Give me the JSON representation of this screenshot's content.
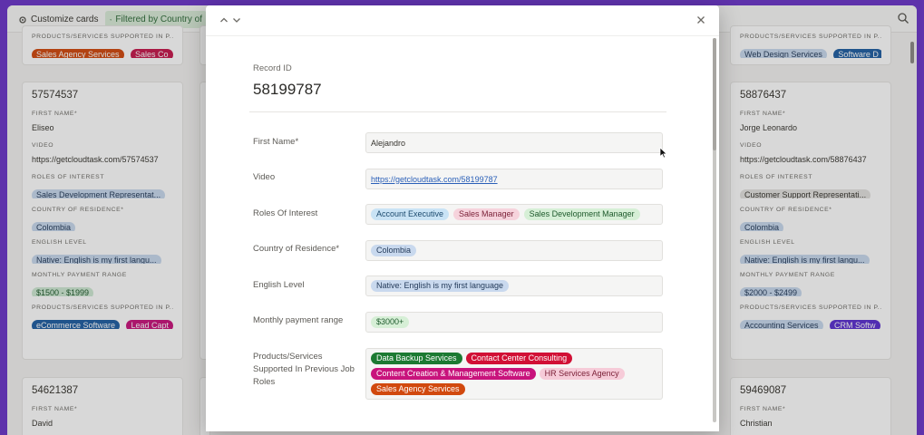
{
  "toolbar": {
    "customize_label": "Customize cards",
    "filter_label": "Filtered by Country of"
  },
  "background_cards": {
    "top_left": {
      "field_label": "PRODUCTS/SERVICES SUPPORTED IN P...",
      "tags": [
        {
          "label": "Sales Agency Services",
          "bg": "#d1490e",
          "fg": "#ffffff"
        },
        {
          "label": "Sales Co",
          "bg": "#c6184c",
          "fg": "#ffffff"
        }
      ]
    },
    "top_right": {
      "field_label": "PRODUCTS/SERVICES SUPPORTED IN P...",
      "tags": [
        {
          "label": "Web Design Services",
          "bg": "#c9d9ee",
          "fg": "#243b5a"
        },
        {
          "label": "Software D",
          "bg": "#1f5fa3",
          "fg": "#ffffff"
        }
      ]
    },
    "left": {
      "title": "57574537",
      "first_name_label": "FIRST NAME*",
      "first_name": "Eliseo",
      "video_label": "VIDEO",
      "video": "https://getcloudtask.com/57574537",
      "roles_label": "ROLES OF INTEREST",
      "role_tag": {
        "label": "Sales Development Representat...",
        "bg": "#c9d9ee",
        "fg": "#243b5a"
      },
      "country_label": "COUNTRY OF RESIDENCE*",
      "country_tag": {
        "label": "Colombia",
        "bg": "#c9d9ee",
        "fg": "#243b5a"
      },
      "english_label": "ENGLISH LEVEL",
      "english_tag": {
        "label": "Native: English is my first langu...",
        "bg": "#c9d9ee",
        "fg": "#243b5a"
      },
      "payment_label": "MONTHLY PAYMENT RANGE",
      "payment_tag": {
        "label": "$1500 - $1999",
        "bg": "#cfe9d3",
        "fg": "#1e5a2c"
      },
      "products_label": "PRODUCTS/SERVICES SUPPORTED IN P...",
      "products_tags": [
        {
          "label": "eCommerce Software",
          "bg": "#1f5fa3",
          "fg": "#ffffff"
        },
        {
          "label": "Lead Capt",
          "bg": "#c8137c",
          "fg": "#ffffff"
        }
      ]
    },
    "right": {
      "title": "58876437",
      "first_name_label": "FIRST NAME*",
      "first_name": "Jorge Leonardo",
      "video_label": "VIDEO",
      "video": "https://getcloudtask.com/58876437",
      "roles_label": "ROLES OF INTEREST",
      "role_tag": {
        "label": "Customer Support Representati...",
        "bg": "#e3e2e0",
        "fg": "#37352f"
      },
      "country_label": "COUNTRY OF RESIDENCE*",
      "country_tag": {
        "label": "Colombia",
        "bg": "#c9d9ee",
        "fg": "#243b5a"
      },
      "english_label": "ENGLISH LEVEL",
      "english_tag": {
        "label": "Native: English is my first langu...",
        "bg": "#c9d9ee",
        "fg": "#243b5a"
      },
      "payment_label": "MONTHLY PAYMENT RANGE",
      "payment_tag": {
        "label": "$2000 - $2499",
        "bg": "#c9d9ee",
        "fg": "#243b5a"
      },
      "products_label": "PRODUCTS/SERVICES SUPPORTED IN P...",
      "products_tags": [
        {
          "label": "Accounting Services",
          "bg": "#c9d9ee",
          "fg": "#243b5a"
        },
        {
          "label": "CRM Softw",
          "bg": "#5b2fd1",
          "fg": "#ffffff"
        }
      ]
    },
    "bottom_left": {
      "title": "54621387",
      "first_name_label": "FIRST NAME*",
      "first_name": "David"
    },
    "bottom_right": {
      "title": "59469087",
      "first_name_label": "FIRST NAME*",
      "first_name": "Christian"
    }
  },
  "modal": {
    "record_id_label": "Record ID",
    "record_id": "58199787",
    "fields": {
      "first_name": {
        "label": "First Name*",
        "value": "Alejandro"
      },
      "video": {
        "label": "Video",
        "value": "https://getcloudtask.com/58199787"
      },
      "roles": {
        "label": "Roles Of Interest",
        "tags": [
          {
            "label": "Account Executive",
            "bg": "#c9e3f5",
            "fg": "#1c4a6e"
          },
          {
            "label": "Sales Manager",
            "bg": "#f6d3dc",
            "fg": "#7a1f36"
          },
          {
            "label": "Sales Development Manager",
            "bg": "#d6efd6",
            "fg": "#1e5a2c"
          }
        ]
      },
      "country": {
        "label": "Country of Residence*",
        "tags": [
          {
            "label": "Colombia",
            "bg": "#c9d9ee",
            "fg": "#243b5a"
          }
        ]
      },
      "english": {
        "label": "English Level",
        "tags": [
          {
            "label": "Native: English is my first language",
            "bg": "#c9d9ee",
            "fg": "#243b5a"
          }
        ]
      },
      "payment": {
        "label": "Monthly payment range",
        "tags": [
          {
            "label": "$3000+",
            "bg": "#d6efd6",
            "fg": "#1e5a2c"
          }
        ]
      },
      "products": {
        "label": "Products/Services Supported In Previous Job Roles",
        "tags": [
          {
            "label": "Data Backup Services",
            "bg": "#1c7a32",
            "fg": "#ffffff"
          },
          {
            "label": "Contact Center Consulting",
            "bg": "#d11035",
            "fg": "#ffffff"
          },
          {
            "label": "Content Creation & Management Software",
            "bg": "#c8137c",
            "fg": "#ffffff"
          },
          {
            "label": "HR Services Agency",
            "bg": "#f6cbd8",
            "fg": "#7a1f36"
          },
          {
            "label": "Sales Agency Services",
            "bg": "#d1490e",
            "fg": "#ffffff"
          }
        ]
      }
    }
  }
}
